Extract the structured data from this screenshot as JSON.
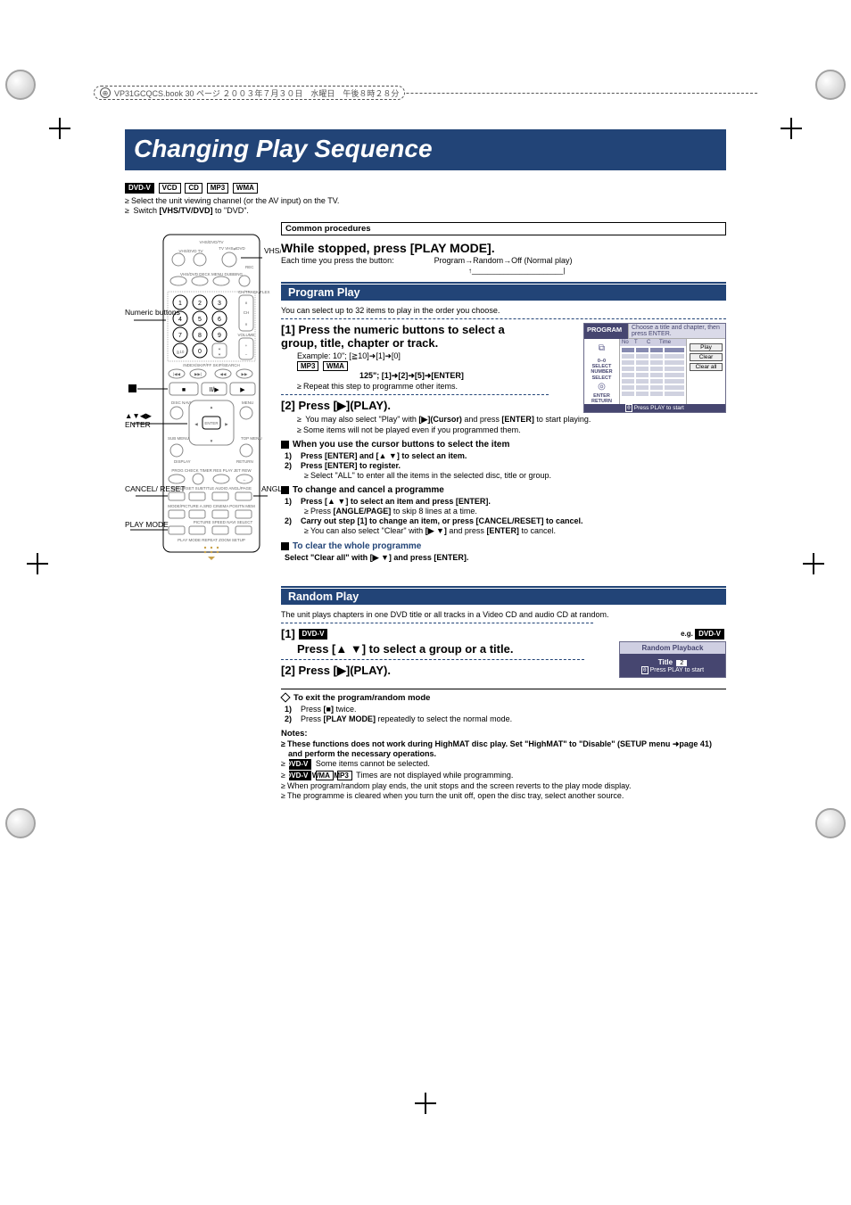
{
  "book_meta": "VP31GCQCS.book  30 ページ  ２００３年７月３０日　水曜日　午後８時２８分",
  "page_title": "Changing Play Sequence",
  "media_tags_top": {
    "dvdv": "DVD-V",
    "vcd": "VCD",
    "cd": "CD",
    "mp3": "MP3",
    "wma": "WMA"
  },
  "top_bullets": {
    "b1": "Select the unit viewing channel (or the AV input) on the TV.",
    "b2_pre": "Switch ",
    "b2_strong": "[VHS/TV/DVD]",
    "b2_post": " to \"DVD\"."
  },
  "common_procedures": "Common procedures",
  "while_stopped": "While stopped, press [PLAY MODE].",
  "cycle_line_left": "Each time you press the button:",
  "cycle_line_right": "Program→Random→Off (Normal play)",
  "cycle_bracket": "↑_______________________|",
  "program_play_heading": "Program Play",
  "program_play_intro": "You can select up to 32 items to play in the order you choose.",
  "step1_title": "[1] Press the numeric buttons to select a group, title, chapter or track.",
  "step1_example": "Example: 10\";  [≧10]➜[1]➜[0]",
  "step1_tags": {
    "mp3": "MP3",
    "wma": "WMA"
  },
  "step1_second": "125\"; [1]➜[2]➜[5]➜[ENTER]",
  "step1_repeat": "Repeat this step to programme other items.",
  "step2_title": "[2] Press [▶](PLAY).",
  "step2_a_pre": "You may also select \"Play\" with ",
  "step2_a_strong": "[▶](Cursor)",
  "step2_a_mid": " and press ",
  "step2_a_strong2": "[ENTER]",
  "step2_a_post": " to start playing.",
  "step2_b": "Some items will not be played even if you programmed them.",
  "sub_cursor_title": "When you use the cursor buttons to select the item",
  "cursor_1": "Press [ENTER] and [▲ ▼] to select an item.",
  "cursor_2": "Press [ENTER] to register.",
  "cursor_2_sub": "Select \"ALL\" to enter all the items in the selected disc, title or group.",
  "sub_change_title": "To change and cancel a programme",
  "change_1": "Press [▲ ▼] to select an item and press [ENTER].",
  "change_1_sub_pre": "Press ",
  "change_1_sub_strong": "[ANGLE/PAGE]",
  "change_1_sub_post": " to skip 8 lines at a time.",
  "change_2": "Carry out step [1] to change an item, or press [CANCEL/RESET] to cancel.",
  "change_2_sub_pre": "You can also select \"Clear\" with ",
  "change_2_sub_strong": "[▶ ▼]",
  "change_2_sub_mid": " and press ",
  "change_2_sub_strong2": "[ENTER]",
  "change_2_sub_post": " to cancel.",
  "sub_clear_title": "To clear the whole programme",
  "clear_line": "Select \"Clear all\" with [▶ ▼] and press [ENTER].",
  "random_heading": "Random Play",
  "random_intro": "The unit plays chapters in one DVD title or all tracks in a Video CD and audio CD at random.",
  "random_step1_tag": "DVD-V",
  "random_step1": "[1]",
  "random_step1_title": "Press [▲ ▼] to select a group or a title.",
  "random_step2": "[2] Press [▶](PLAY).",
  "exit_title": "To exit the program/random mode",
  "exit_1_pre": "Press ",
  "exit_1_strong": "[■]",
  "exit_1_post": " twice.",
  "exit_2_pre": "Press ",
  "exit_2_strong": "[PLAY MODE]",
  "exit_2_post": " repeatedly to select the normal mode.",
  "notes_head": "Notes:",
  "note_a": "These functions does not work during HighMAT disc play. Set \"HighMAT\" to \"Disable\" (SETUP menu ➜page 41) and perform the necessary operations.",
  "note_b_tag": "DVD-V",
  "note_b": " Some items cannot be selected.",
  "note_c_tags": {
    "dvdv": "DVD-V",
    "wma": "WMA",
    "mp3": "MP3"
  },
  "note_c": " Times are not displayed while programming.",
  "note_d": "When program/random play ends, the unit stops and the screen reverts to the play mode display.",
  "note_e": "The programme is cleared when you turn the unit off, open the disc tray, select another source.",
  "remote_labels": {
    "numeric": "Numeric\nbuttons",
    "enter": "ENTER",
    "cancel": "CANCEL/\nRESET",
    "playmode": "PLAY MODE",
    "angle": "ANGLE/\nPAGE",
    "devices": "VHS/\nTV/\nDVD",
    "arrows": "▲▼◀▶",
    "stop": "■",
    "play": "▶",
    "pause_like": "II/▶"
  },
  "prog_fig": {
    "title": "PROGRAM",
    "hint": "Choose a title and chapter, then press ENTER.",
    "cols": {
      "no": "No",
      "t": "T",
      "c": "C",
      "time": "Time"
    },
    "left": {
      "num_icon": "0–0",
      "num_lbl": "SELECT\nNUMBER",
      "sel_lbl": "SELECT",
      "ret_lbl": "ENTER  RETURN"
    },
    "btn_play": "Play",
    "btn_clear": "Clear",
    "btn_clear_all": "Clear all",
    "footer": "Press PLAY to start"
  },
  "random_fig": {
    "eg_pre": "e.g. ",
    "eg_tag": "DVD-V",
    "head": "Random Playback",
    "title_label": "Title",
    "title_val": "2",
    "foot": "Press PLAY to start"
  },
  "remote_text": {
    "vhs_dvd_tv": "VHS/DVD/TV",
    "vhs_tv": "VHS/DVD   TV",
    "tv_vhsdvd": "TV\nVHS⇌DVD",
    "rec": "REC",
    "row1": "VHS/DVD   DECK MENU   DUBBING",
    "chtrk": "CH/TRACK/FLEX",
    "ch": "CH",
    "volume": "VOLUME",
    "ge10": "≧10",
    "zero": "0",
    "sbar": "INDEX/SKIP/FF                 SKIP/SEARCH",
    "dcnav": "DISC\nNAVIGATOR",
    "menu": "MENU",
    "sub": "SUB\nMENU",
    "topm": "TOP\nMENU",
    "display": "DISPLAY",
    "return": "RETURN",
    "row2": "PROG CHECK   TIMER   RES PLAY   JET REW",
    "row3": "CNCL/RSET  SUBTITLE   AUDIO   ANGL/PAGE",
    "row4": "MODE/PICTURE  A.SRD    CINEMA  POSITN MEM",
    "row5": "PICTURE   SPEED   NAVI SELECT",
    "row6": "PLAY MODE  REPEAT   ZOOM   SETUP"
  }
}
